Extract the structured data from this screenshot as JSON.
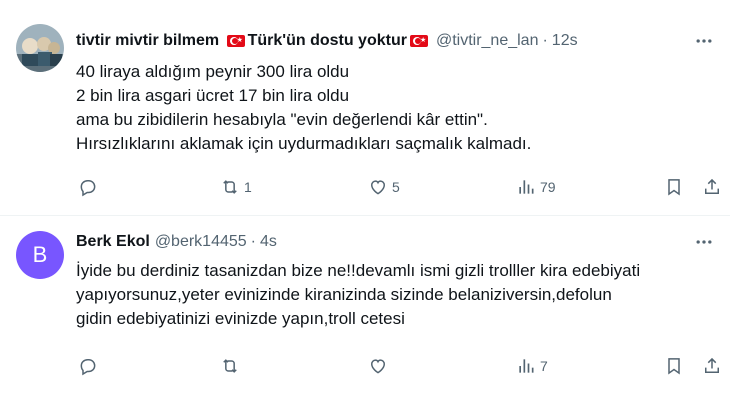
{
  "tweets": [
    {
      "display_name_parts": [
        "tivtir mivtir bilmem ",
        "Türk'ün dostu yoktur"
      ],
      "handle": "@tivtir_ne_lan",
      "separator": "·",
      "time": "12s",
      "lines": [
        "40 liraya aldığım peynir 300 lira oldu",
        "2 bin lira asgari ücret 17 bin lira oldu",
        "ama bu zibidilerin hesabıyla \"evin değerlendi kâr ettin\".",
        "Hırsızlıklarını aklamak için uydurmadıkları saçmalık kalmadı."
      ],
      "replies": "",
      "retweets": "1",
      "likes": "5",
      "views": "79"
    },
    {
      "avatar_letter": "B",
      "display_name": "Berk Ekol",
      "handle": "@berk14455",
      "separator": "·",
      "time": "4s",
      "lines": [
        "İyide bu derdiniz tasanizdan bize ne!!devamlı ismi gizli trolller kira edebiyati",
        "yapıyorsunuz,yeter evinizinde kiranizinda sizinde belaniziversin,defolun",
        "gidin edebiyatinizi evinizde yapın,troll cetesi"
      ],
      "replies": "",
      "retweets": "",
      "likes": "",
      "views": "7"
    }
  ],
  "icons": {
    "more": "more-horizontal-icon",
    "reply": "reply-icon",
    "retweet": "retweet-icon",
    "like": "heart-icon",
    "views": "views-icon",
    "bookmark": "bookmark-icon",
    "share": "share-icon"
  },
  "colors": {
    "text_primary": "#0f1419",
    "text_secondary": "#536471",
    "divider": "#eff3f4",
    "flag_red": "#e30a17",
    "avatar_purple": "#7856ff"
  }
}
